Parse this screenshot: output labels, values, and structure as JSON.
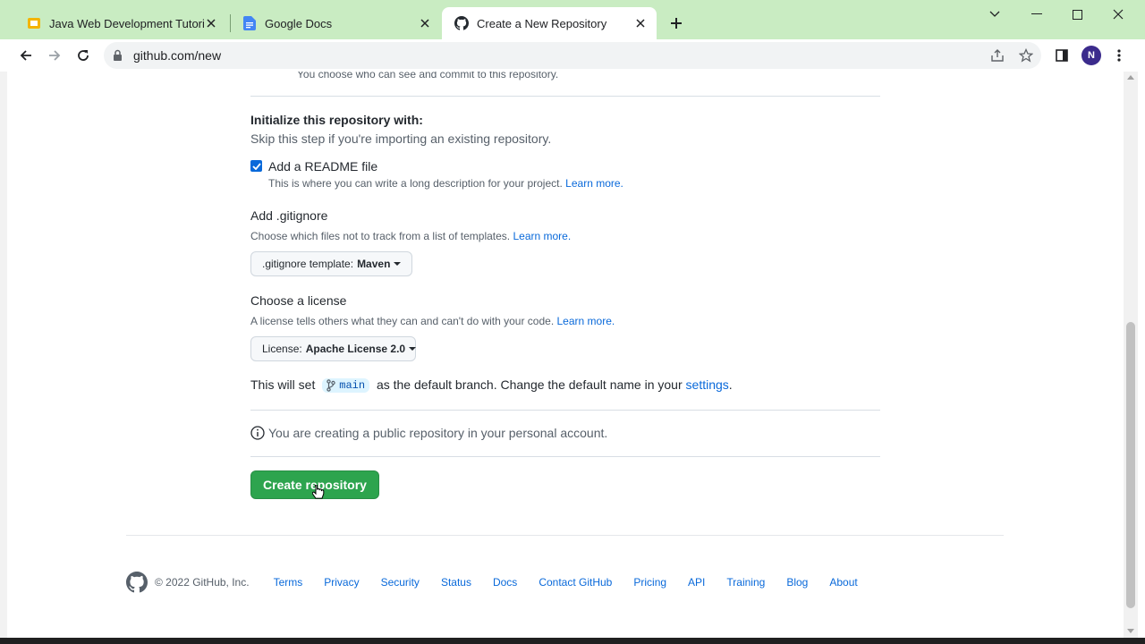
{
  "browser": {
    "tabs": [
      {
        "title": "Java Web Development Tutorial",
        "favicon": "slides-icon",
        "active": false
      },
      {
        "title": "Google Docs",
        "favicon": "docs-icon",
        "active": false
      },
      {
        "title": "Create a New Repository",
        "favicon": "github-icon",
        "active": true
      }
    ],
    "url": "github.com/new",
    "profile_initial": "N",
    "tabstrip_color": "#c9ecc2"
  },
  "page": {
    "visibility_hint": "You choose who can see and commit to this repository.",
    "init": {
      "heading": "Initialize this repository with:",
      "subtext": "Skip this step if you're importing an existing repository."
    },
    "readme": {
      "checked": true,
      "label": "Add a README file",
      "description": "This is where you can write a long description for your project.",
      "learn_more": "Learn more."
    },
    "gitignore": {
      "heading": "Add .gitignore",
      "description": "Choose which files not to track from a list of templates.",
      "learn_more": "Learn more.",
      "select_label": ".gitignore template:",
      "select_value": "Maven"
    },
    "license": {
      "heading": "Choose a license",
      "description": "A license tells others what they can and can't do with your code.",
      "learn_more": "Learn more.",
      "select_label": "License:",
      "select_value": "Apache License 2.0"
    },
    "branch": {
      "prefix": "This will set",
      "branch_name": "main",
      "suffix": "as the default branch. Change the default name in your",
      "settings_link": "settings",
      "end": "."
    },
    "notice": "You are creating a public repository in your personal account.",
    "create_button": "Create repository"
  },
  "footer": {
    "copyright": "© 2022 GitHub, Inc.",
    "links": [
      "Terms",
      "Privacy",
      "Security",
      "Status",
      "Docs",
      "Contact GitHub",
      "Pricing",
      "API",
      "Training",
      "Blog",
      "About"
    ]
  },
  "colors": {
    "accent_green": "#2da44e",
    "link_blue": "#0969da"
  }
}
